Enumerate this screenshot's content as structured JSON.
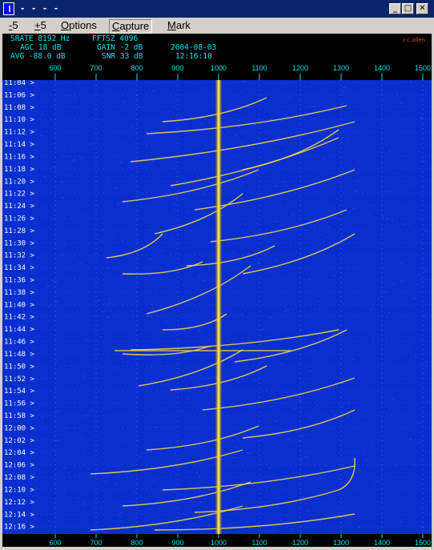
{
  "window": {
    "title": "- - - -",
    "minimize_symbol": "_",
    "maximize_symbol": "□",
    "close_symbol": "✕"
  },
  "menu": [
    {
      "underline": "-",
      "rest": "5"
    },
    {
      "underline": "+",
      "rest": "5"
    },
    {
      "underline": "O",
      "rest": "ptions"
    },
    {
      "underline": "C",
      "rest": "apture"
    },
    {
      "underline": "M",
      "rest": "ark"
    }
  ],
  "info": {
    "srate": "SRATE 8192 Hz",
    "fftsz": "FFTSZ 4096",
    "agc": "AGC 18 dB",
    "gain": "GAIN -2 dB",
    "date": "2004-08-03",
    "avg": "AVG -88.0 dB",
    "snr": "SNR 33 dB",
    "time": "12:16:10",
    "credit": "r.c.allen"
  },
  "spectrogram": {
    "freq_ticks": [
      600,
      700,
      800,
      900,
      1000,
      1100,
      1200,
      1300,
      1400,
      1500
    ],
    "time_labels": [
      "11:04",
      "11:06",
      "11:08",
      "11:10",
      "11:12",
      "11:14",
      "11:16",
      "11:18",
      "11:20",
      "11:22",
      "11:24",
      "11:26",
      "11:28",
      "11:30",
      "11:32",
      "11:34",
      "11:36",
      "11:38",
      "11:40",
      "11:42",
      "11:44",
      "11:46",
      "11:48",
      "11:50",
      "11:52",
      "11:54",
      "11:56",
      "11:58",
      "12:00",
      "12:02",
      "12:04",
      "12:06",
      "12:08",
      "12:10",
      "12:12",
      "12:14",
      "12:16"
    ],
    "carrier_freq_hz": 1000,
    "colors": {
      "background": "#0a2fcf",
      "trace": "#ffe040",
      "axis_text": "#00e5ee",
      "grid": "#c8c8c8"
    }
  }
}
